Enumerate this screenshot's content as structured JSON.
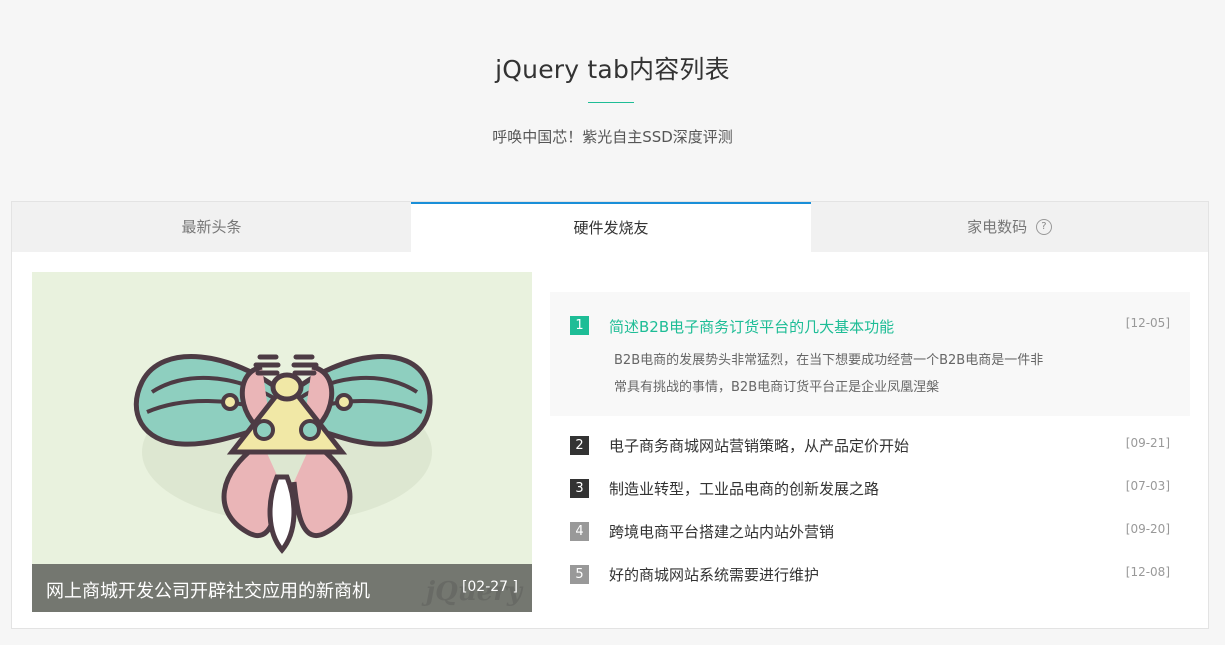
{
  "header": {
    "title": "jQuery tab内容列表",
    "subtitle": "呼唤中国芯！紫光自主SSD深度评测"
  },
  "tabs": [
    {
      "label": "最新头条"
    },
    {
      "label": "硬件发烧友"
    },
    {
      "label": "家电数码"
    }
  ],
  "help_icon": {
    "glyph": "?"
  },
  "feature": {
    "title": "网上商城开发公司开辟社交应用的新商机",
    "date": "[02-27 ]",
    "watermark": "jQuery"
  },
  "news": [
    {
      "num": "1",
      "title": "简述B2B电子商务订货平台的几大基本功能",
      "date": "[12-05]",
      "desc": "B2B电商的发展势头非常猛烈，在当下想要成功经营一个B2B电商是一件非常具有挑战的事情，B2B电商订货平台正是企业凤凰涅槃"
    },
    {
      "num": "2",
      "title": "电子商务商城网站营销策略，从产品定价开始",
      "date": "[09-21]"
    },
    {
      "num": "3",
      "title": "制造业转型，工业品电商的创新发展之路",
      "date": "[07-03]"
    },
    {
      "num": "4",
      "title": "跨境电商平台搭建之站内站外营销",
      "date": "[09-20]"
    },
    {
      "num": "5",
      "title": "好的商城网站系统需要进行维护",
      "date": "[12-08]"
    }
  ],
  "colors": {
    "accent": "#1ebd96",
    "active_tab": "#1a8fd8"
  }
}
